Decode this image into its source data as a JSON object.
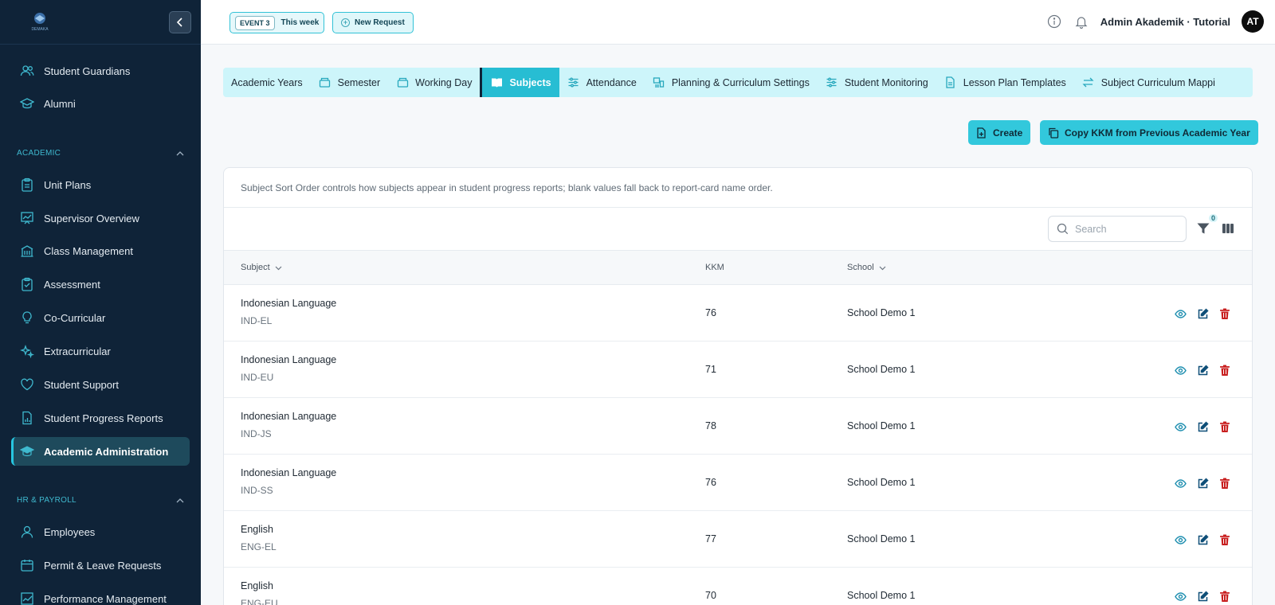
{
  "sidebar": {
    "logo_text": "DEMAKA",
    "items_top": [
      {
        "label": "Student Guardians",
        "icon": "users-icon"
      },
      {
        "label": "Alumni",
        "icon": "graduation-cap-icon"
      }
    ],
    "section_academic": "ACADEMIC",
    "items_academic": [
      {
        "label": "Unit Plans",
        "icon": "clipboard-icon"
      },
      {
        "label": "Supervisor Overview",
        "icon": "presentation-chart-icon"
      },
      {
        "label": "Class Management",
        "icon": "building-icon"
      },
      {
        "label": "Assessment",
        "icon": "clipboard-check-icon"
      },
      {
        "label": "Co-Curricular",
        "icon": "lightbulb-icon"
      },
      {
        "label": "Extracurricular",
        "icon": "sparkles-icon"
      },
      {
        "label": "Student Support",
        "icon": "heart-icon"
      },
      {
        "label": "Student Progress Reports",
        "icon": "report-icon"
      },
      {
        "label": "Academic Administration",
        "icon": "graduation-cap-icon"
      }
    ],
    "section_hr": "HR & PAYROLL",
    "items_hr": [
      {
        "label": "Employees",
        "icon": "user-icon"
      },
      {
        "label": "Permit & Leave Requests",
        "icon": "calendar-icon"
      },
      {
        "label": "Performance Management",
        "icon": "chart-icon"
      }
    ]
  },
  "topbar": {
    "event_tag": "EVENT 3",
    "event_label": "This week",
    "new_request": "New Request",
    "user": "Admin Akademik · Tutorial",
    "avatar": "AT"
  },
  "tabs": [
    {
      "label": "Academic Years"
    },
    {
      "label": "Semester"
    },
    {
      "label": "Working Day"
    },
    {
      "label": "Subjects"
    },
    {
      "label": "Attendance"
    },
    {
      "label": "Planning & Curriculum Settings"
    },
    {
      "label": "Student Monitoring"
    },
    {
      "label": "Lesson Plan Templates"
    },
    {
      "label": "Subject Curriculum Mappi"
    }
  ],
  "actions": {
    "create": "Create",
    "copy_kkm": "Copy KKM from Previous Academic Year"
  },
  "card": {
    "note": "Subject Sort Order controls how subjects appear in student progress reports; blank values fall back to report-card name order.",
    "search_placeholder": "Search",
    "filter_count": "0"
  },
  "table": {
    "columns": {
      "subject": "Subject",
      "kkm": "KKM",
      "school": "School"
    },
    "rows": [
      {
        "name": "Indonesian Language",
        "code": "IND-EL",
        "kkm": "76",
        "school": "School Demo 1"
      },
      {
        "name": "Indonesian Language",
        "code": "IND-EU",
        "kkm": "71",
        "school": "School Demo 1"
      },
      {
        "name": "Indonesian Language",
        "code": "IND-JS",
        "kkm": "78",
        "school": "School Demo 1"
      },
      {
        "name": "Indonesian Language",
        "code": "IND-SS",
        "kkm": "76",
        "school": "School Demo 1"
      },
      {
        "name": "English",
        "code": "ENG-EL",
        "kkm": "77",
        "school": "School Demo 1"
      },
      {
        "name": "English",
        "code": "ENG-EU",
        "kkm": "70",
        "school": "School Demo 1"
      }
    ]
  },
  "colors": {
    "sidebar_bg": "#0f2338",
    "accent": "#27bdd3",
    "delete": "#c81e1e"
  }
}
